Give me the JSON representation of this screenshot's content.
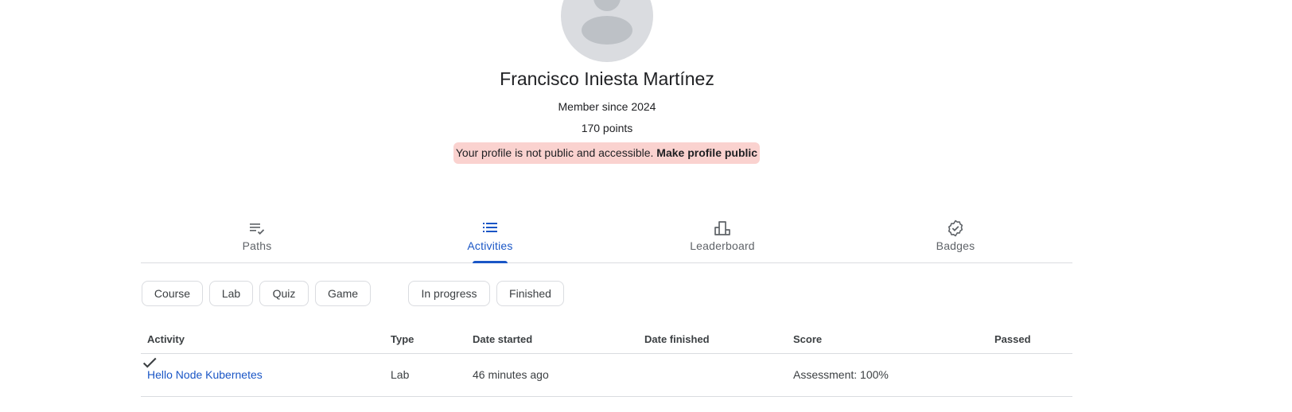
{
  "profile": {
    "name": "Francisco Iniesta Martínez",
    "member_since": "Member since 2024",
    "points": "170 points",
    "notice_text": "Your profile is not public and accessible.",
    "notice_link": "Make profile public"
  },
  "tabs": [
    {
      "label": "Paths",
      "icon": "checklist-icon"
    },
    {
      "label": "Activities",
      "icon": "list-icon",
      "active": true
    },
    {
      "label": "Leaderboard",
      "icon": "leaderboard-icon"
    },
    {
      "label": "Badges",
      "icon": "verified-badge-icon"
    }
  ],
  "filters": {
    "type_chips": [
      "Course",
      "Lab",
      "Quiz",
      "Game"
    ],
    "status_chips": [
      "In progress",
      "Finished"
    ]
  },
  "table": {
    "headers": [
      "Activity",
      "Type",
      "Date started",
      "Date finished",
      "Score",
      "Passed"
    ],
    "rows": [
      {
        "activity": "Hello Node Kubernetes",
        "type": "Lab",
        "date_started": "46 minutes ago",
        "date_finished": "",
        "score": "Assessment: 100%",
        "passed_icon": "checkmark-icon"
      }
    ]
  },
  "colors": {
    "accent": "#1a56c6",
    "notice_bg": "#fad2cf",
    "divider": "#dadce0"
  }
}
